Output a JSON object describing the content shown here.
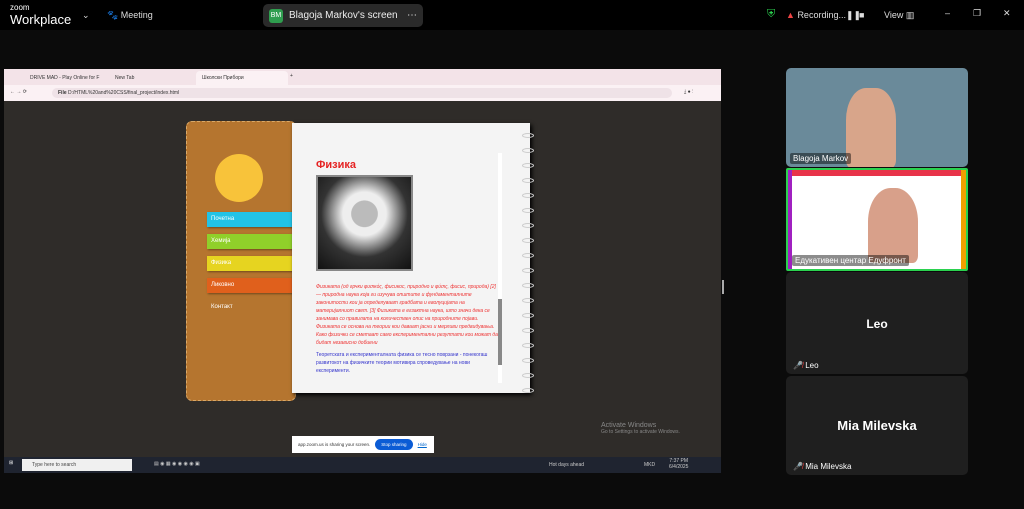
{
  "zoom": {
    "brand_small": "zoom",
    "brand": "Workplace",
    "meeting_label": "Meeting",
    "share_initials": "BM",
    "share_title": "Blagoja Markov's screen",
    "recording": "Recording...",
    "view": "View"
  },
  "browser": {
    "tabs": [
      "DRIVE MAD - Play Online for F",
      "New Tab",
      "Школски Прибори"
    ],
    "url_prefix": "File",
    "url": "D:/HTML%20and%20CSS/final_project/index.html"
  },
  "site": {
    "menu": [
      "Почетна",
      "Хемија",
      "Физика",
      "Ликовно",
      "Контакт"
    ],
    "heading": "Физика",
    "para1": "Физиката (од грчки φυσικός, фисикос, природно и φύσις, фисис, природа) [2] — природна наука која ги изучува општите и фундаменталните законитости кои ја определуваат градбата и еволуцијата на материјалниот свет. [3] Физиката е егзактна наука, што значи дека се занимава со правилата на количествен опис на природните појави. Физиката се основа на теории кои даваат јасни и мерливи предвидувања. Како физички се сметаат само експериментални резултати кои можат да бидат независно добиени",
    "para2": "Теоретската и експерименталната физика се тесно поврзани - понекогаш развитокот на физичките теории мотивира спроведување на нови експерименти."
  },
  "sharing_bar": {
    "text": "app.zoom.us is sharing your screen.",
    "stop": "Stop sharing",
    "hide": "Hide"
  },
  "activate": {
    "title": "Activate Windows",
    "sub": "Go to Settings to activate Windows."
  },
  "taskbar": {
    "search": "Type here to search",
    "weather": "Hot days ahead",
    "time": "7:37 PM",
    "date": "6/4/2025",
    "lang": "MKD"
  },
  "participants": [
    {
      "name": "Blagoja Markov"
    },
    {
      "name": "Едукативен центар Едуфронт"
    },
    {
      "name": "Leo"
    },
    {
      "name": "Mia Milevska"
    }
  ]
}
